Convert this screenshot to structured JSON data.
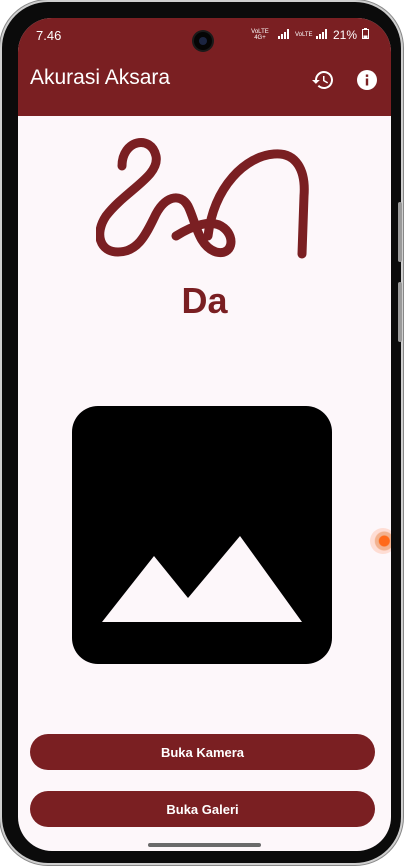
{
  "status_bar": {
    "time": "7.46",
    "sim1_label": "VoLTE 4G+",
    "sim2_label": "VoLTE",
    "battery": "21%"
  },
  "app_bar": {
    "title": "Akurasi Aksara",
    "icons": [
      "history-icon",
      "info-icon"
    ]
  },
  "character": {
    "name": "Da"
  },
  "image_placeholder": {
    "icon": "image-placeholder-icon"
  },
  "buttons": {
    "camera": "Buka Kamera",
    "gallery": "Buka Galeri"
  },
  "colors": {
    "primary": "#7a1f22",
    "background": "#fdf7fa",
    "placeholder": "#000000"
  }
}
